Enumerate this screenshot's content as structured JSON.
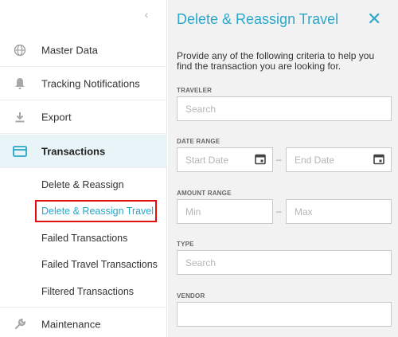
{
  "sidebar": {
    "collapse_icon": "‹",
    "items": [
      {
        "label": "Master Data",
        "icon": "globe-icon"
      },
      {
        "label": "Tracking Notifications",
        "icon": "bell-icon"
      },
      {
        "label": "Export",
        "icon": "download-icon"
      },
      {
        "label": "Transactions",
        "icon": "card-icon"
      },
      {
        "label": "Maintenance",
        "icon": "wrench-icon"
      }
    ],
    "sub_items": [
      {
        "label": "Delete & Reassign"
      },
      {
        "label": "Delete & Reassign Travel"
      },
      {
        "label": "Failed Transactions"
      },
      {
        "label": "Failed Travel Transactions"
      },
      {
        "label": "Filtered Transactions"
      }
    ]
  },
  "panel": {
    "title": "Delete & Reassign Travel",
    "close": "✕",
    "description": "Provide any of the following criteria to help you find the transaction you are looking for.",
    "traveler": {
      "label": "TRAVELER",
      "placeholder": "Search"
    },
    "date_range": {
      "label": "DATE RANGE",
      "start_placeholder": "Start Date",
      "end_placeholder": "End Date",
      "separator": "–"
    },
    "amount_range": {
      "label": "AMOUNT RANGE",
      "min_placeholder": "Min",
      "max_placeholder": "Max",
      "separator": "–"
    },
    "type": {
      "label": "TYPE",
      "placeholder": "Search"
    },
    "vendor": {
      "label": "VENDOR",
      "placeholder": ""
    }
  },
  "colors": {
    "accent": "#2aa7c9",
    "highlight_border": "#e01010",
    "active_bg": "#e8f4f7"
  }
}
